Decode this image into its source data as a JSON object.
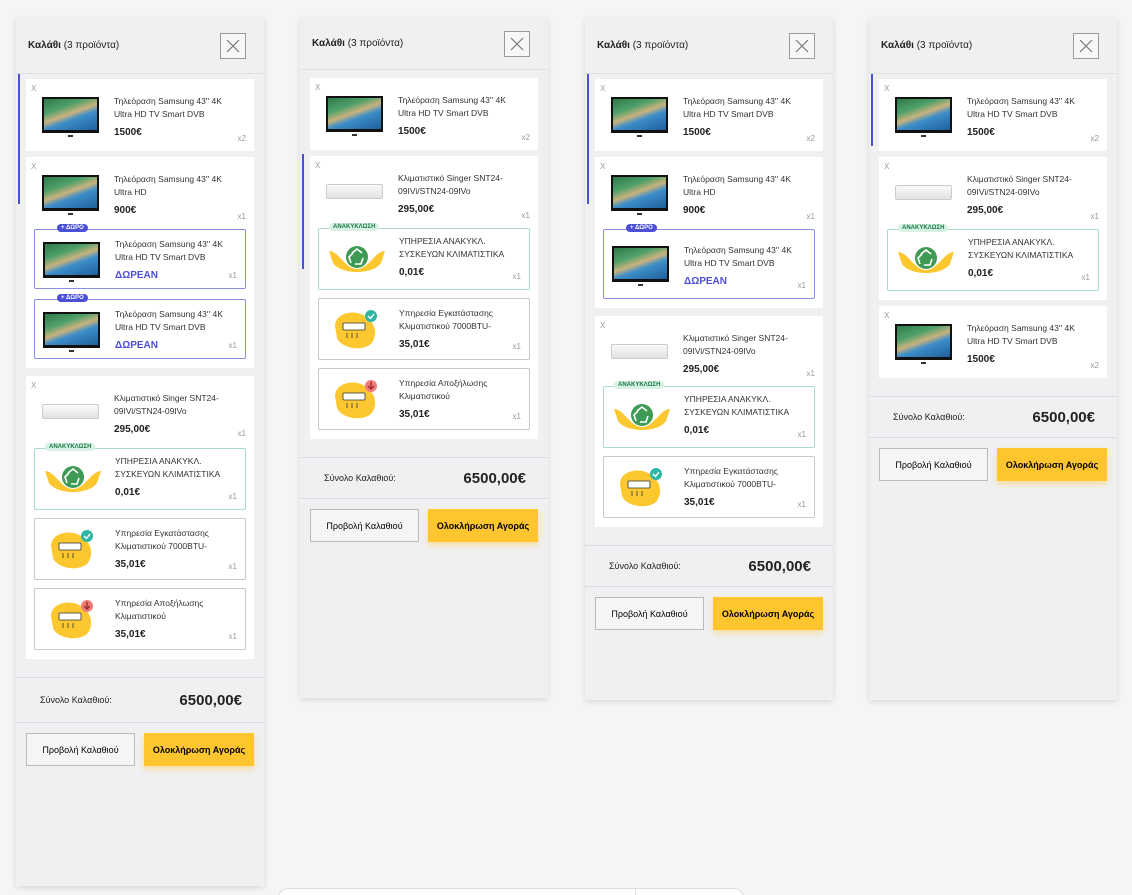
{
  "cart": {
    "title": "Καλάθι",
    "count": "(3 προϊόντα)",
    "total_label": "Σύνολο Καλαθιού:",
    "total_value": "6500,00€",
    "view_label": "Προβολή Καλαθιού",
    "checkout_label": "Ολοκλήρωση Αγοράς",
    "remove": "X"
  },
  "products": {
    "tv1": {
      "name": "Τηλεόραση Samsung 43'' 4K Ultra HD TV Smart DVB",
      "price": "1500€",
      "qty": "x2"
    },
    "tv2": {
      "name": "Τηλεόραση Samsung 43'' 4K Ultra HD",
      "price": "900€",
      "qty": "x1"
    },
    "gift": {
      "badge": "+ ΔΩΡΟ",
      "name": "Τηλεόραση Samsung 43'' 4K Ultra HD TV Smart DVB",
      "price": "ΔΩΡΕΑΝ",
      "qty": "x1"
    },
    "ac": {
      "name": "Κλιματιστικό Singer SNT24-09IVi/STN24-09IVo",
      "price": "295,00€",
      "qty": "x1"
    },
    "recycle": {
      "badge": "ΑΝΑΚΥΚΛΩΣΗ",
      "name": "ΥΠΗΡΕΣΙΑ ΑΝΑΚΥΚΛ. ΣΥΣΚΕΥΩΝ ΚΛΙΜΑΤΙΣΤΙΚΑ",
      "price": "0,01€",
      "qty": "x1"
    },
    "install": {
      "name": "Υπηρεσία Εγκατάστασης Κλιματιστικού 7000BTU-",
      "price": "35,01€",
      "qty": "x1"
    },
    "uninstall": {
      "name": "Υπηρεσία Αποξήλωσης Κλιματιστικού",
      "price": "35,01€",
      "qty": "x1"
    }
  },
  "colors": {
    "accent": "#4a4fd6",
    "checkout": "#fec52e",
    "recycle_green": "#1b7a48",
    "service_yellow": "#fcc72f"
  }
}
